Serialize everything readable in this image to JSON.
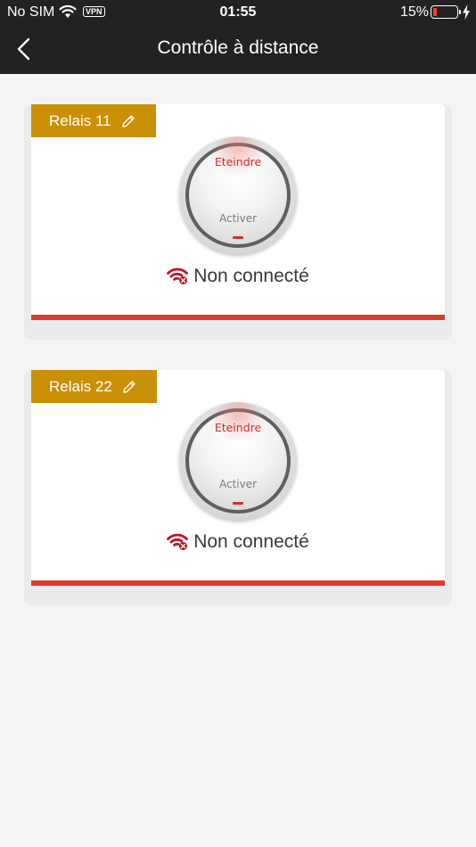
{
  "status_bar": {
    "carrier": "No SIM",
    "vpn": "VPN",
    "time": "01:55",
    "battery_percent": "15%",
    "battery_level": 0.15,
    "battery_color": "#ff3b30"
  },
  "header": {
    "back_icon": "chevron-left-icon",
    "title": "Contrôle à distance"
  },
  "relays": [
    {
      "name": "Relais 11",
      "edit_icon": "pencil-icon",
      "knob_off_label": "Eteindre",
      "knob_on_label": "Activer",
      "connection_icon": "wifi-off-icon",
      "connection_status": "Non connecté"
    },
    {
      "name": "Relais 22",
      "edit_icon": "pencil-icon",
      "knob_off_label": "Eteindre",
      "knob_on_label": "Activer",
      "connection_icon": "wifi-off-icon",
      "connection_status": "Non connecté"
    }
  ],
  "colors": {
    "header_bg": "#222222",
    "tag_bg": "#c98f05",
    "accent_red": "#e03a2a",
    "page_bg": "#f4f4f4"
  }
}
